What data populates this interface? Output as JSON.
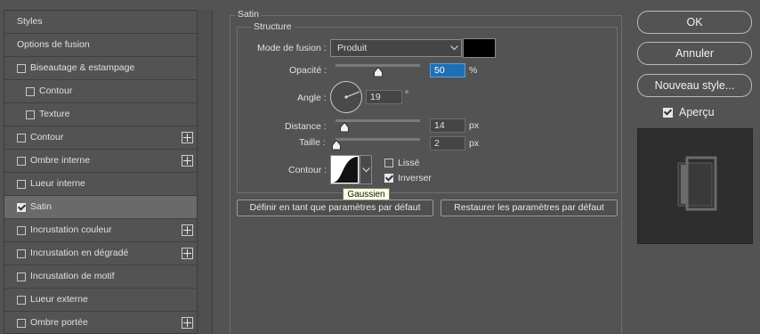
{
  "styles_list": {
    "items": [
      {
        "label": "Styles"
      },
      {
        "label": "Options de fusion"
      },
      {
        "label": "Biseautage & estampage",
        "checked": false
      },
      {
        "label": "Contour",
        "checked": false
      },
      {
        "label": "Texture",
        "checked": false
      },
      {
        "label": "Contour",
        "checked": false
      },
      {
        "label": "Ombre interne",
        "checked": false
      },
      {
        "label": "Lueur interne",
        "checked": false
      },
      {
        "label": "Satin",
        "checked": true,
        "selected": true
      },
      {
        "label": "Incrustation couleur",
        "checked": false
      },
      {
        "label": "Incrustation en dégradé",
        "checked": false
      },
      {
        "label": "Incrustation de motif",
        "checked": false
      },
      {
        "label": "Lueur externe",
        "checked": false
      },
      {
        "label": "Ombre portée",
        "checked": false
      }
    ]
  },
  "satin": {
    "title": "Satin",
    "structure_title": "Structure",
    "blend_mode_label": "Mode de fusion :",
    "blend_mode_value": "Produit",
    "color": "#000000",
    "opacity_label": "Opacité :",
    "opacity_value": "50",
    "opacity_unit": "%",
    "opacity_fraction": 0.5,
    "angle_label": "Angle :",
    "angle_value": "19",
    "angle_unit": "°",
    "distance_label": "Distance :",
    "distance_value": "14",
    "distance_unit": "px",
    "distance_fraction": 0.1,
    "size_label": "Taille :",
    "size_value": "2",
    "size_unit": "px",
    "size_fraction": 0.01,
    "contour_label": "Contour :",
    "smooth_label": "Lissé",
    "smooth_checked": false,
    "invert_label": "Inverser",
    "invert_checked": true,
    "tooltip": "Gaussien",
    "default_button": "Définir en tant que paramètres par défaut",
    "reset_button": "Restaurer les paramètres par défaut"
  },
  "dialog_buttons": {
    "ok": "OK",
    "cancel": "Annuler",
    "new_style": "Nouveau style..."
  },
  "preview": {
    "label": "Aperçu",
    "checked": true
  },
  "colors": {
    "background": "#535353",
    "selected_row": "#6a6a6a",
    "highlight_field": "#1f6fb5"
  }
}
